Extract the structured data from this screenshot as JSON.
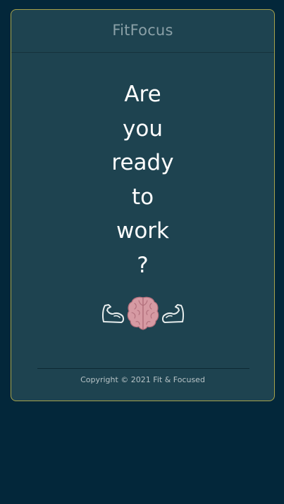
{
  "header": {
    "title": "FitFocus"
  },
  "hero": {
    "words": [
      "Are",
      "you",
      "ready",
      "to",
      "work",
      "?"
    ]
  },
  "icons": {
    "left": "flexed-arm-left-icon",
    "center": "brain-icon",
    "right": "flexed-arm-right-icon"
  },
  "footer": {
    "copyright": "Copyright © 2021 Fit & Focused"
  },
  "colors": {
    "page_background": "#03273a",
    "card_background": "#1e4350",
    "card_border": "#a7a24a",
    "brain": "#d69aa3"
  }
}
